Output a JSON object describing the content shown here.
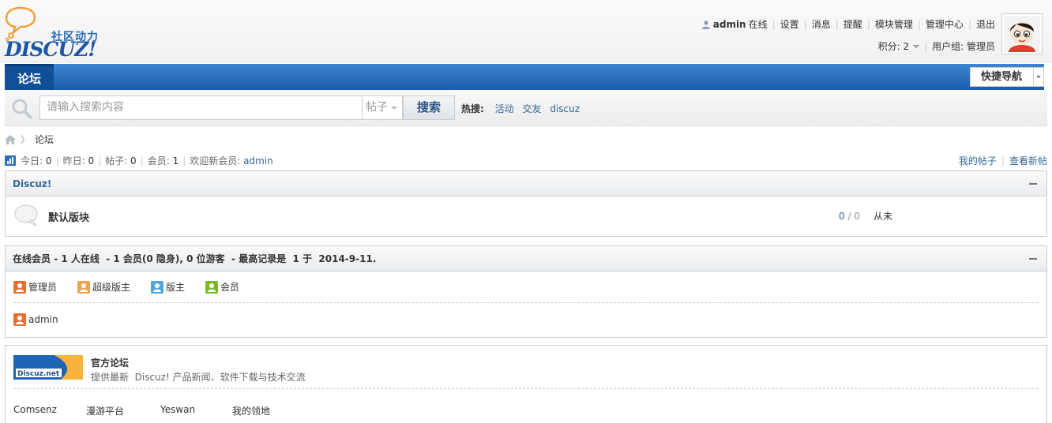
{
  "logo": {
    "cn": "社区动力",
    "brand": "DISCUZ!"
  },
  "header": {
    "username": "admin",
    "status": "在线",
    "nav": [
      "设置",
      "消息",
      "提醒",
      "模块管理",
      "管理中心",
      "退出"
    ],
    "credits_label": "积分: 2",
    "group_label": "用户组: 管理员"
  },
  "navbar": {
    "tab": "论坛",
    "quicknav": "快捷导航"
  },
  "search": {
    "placeholder": "请输入搜索内容",
    "type": "帖子",
    "button": "搜索",
    "hot_label": "热搜:",
    "hot_items": [
      "活动",
      "交友",
      "discuz"
    ]
  },
  "breadcrumb": {
    "current": "论坛"
  },
  "stats": {
    "today_label": "今日:",
    "today": "0",
    "yesterday_label": "昨日:",
    "yesterday": "0",
    "posts_label": "帖子:",
    "posts": "0",
    "members_label": "会员:",
    "members": "1",
    "newest_label": "欢迎新会员:",
    "newest": "admin",
    "my_posts": "我的帖子",
    "new_posts": "查看新帖"
  },
  "category": {
    "title": "Discuz!",
    "forum_name": "默认版块",
    "threads": "0",
    "posts_sep": " / ",
    "posts": "0",
    "last_post": "从未"
  },
  "online": {
    "title": "在线会员",
    "summary": " - 1 人在线  - 1 会员(0 隐身), 0 位游客  - 最高记录是  1 于  2014-9-11.",
    "legend": [
      {
        "label": "管理员",
        "color": "#e8702e"
      },
      {
        "label": "超级版主",
        "color": "#f0a24e"
      },
      {
        "label": "版主",
        "color": "#4da6dd"
      },
      {
        "label": "会员",
        "color": "#7cb928"
      }
    ],
    "users": [
      "admin"
    ]
  },
  "links": {
    "logo_text": "Discuz.net",
    "title": "官方论坛",
    "desc": "提供最新  Discuz! 产品新闻、软件下载与技术交流",
    "items": [
      "Comsenz",
      "漫游平台",
      "Yeswan",
      "我的领地"
    ]
  }
}
